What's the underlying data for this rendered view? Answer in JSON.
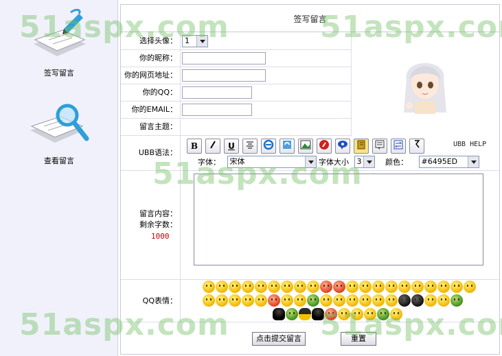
{
  "sidebar": {
    "items": [
      {
        "label": "签写留言",
        "icon": "pen-paper-icon"
      },
      {
        "label": "查看留言",
        "icon": "magnifier-paper-icon"
      }
    ]
  },
  "form": {
    "title": "签写留言",
    "avatar_label": "选择头像：",
    "avatar_value": "1",
    "nickname_label": "你的昵称：",
    "homepage_label": "你的网页地址：",
    "qq_label": "你的QQ：",
    "email_label": "你的EMAIL：",
    "subject_label": "留言主题："
  },
  "ubb": {
    "label": "UBB语法：",
    "help": "UBB HELP",
    "font_label": "字体：",
    "font_value": "宋体",
    "size_label": "字体大小",
    "size_value": "3",
    "color_label": "颜色：",
    "color_value": "#6495ED"
  },
  "content": {
    "label": "留言内容：",
    "remaining_label": "剩余字数：",
    "remaining_value": "1000"
  },
  "emoticons": {
    "label": "QQ表情："
  },
  "buttons": {
    "submit": "点击提交留言",
    "reset": "重置"
  },
  "watermark": {
    "text": "51aspx.com"
  }
}
